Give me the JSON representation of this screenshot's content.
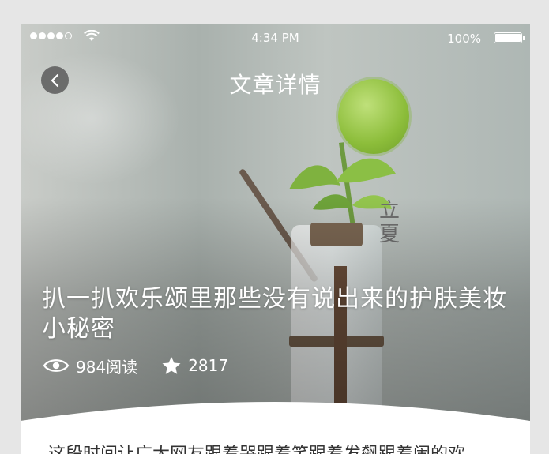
{
  "status_bar": {
    "time": "4:34 PM",
    "battery_percent": "100%",
    "signal_strength": 4,
    "signal_max": 5,
    "wifi_icon": "wifi-icon"
  },
  "nav": {
    "title": "文章详情",
    "back_icon": "chevron-left-icon"
  },
  "hero": {
    "stamp_text": "立夏"
  },
  "article": {
    "title": "扒一扒欢乐颂里那些没有说出来的护肤美妆小秘密",
    "views": "984阅读",
    "likes": "2817",
    "body_preview": "这段时间让广大网友跟着哭跟着笑跟着发飙跟着闹的欢"
  },
  "colors": {
    "back_button_bg": "#5a5a5a",
    "text_on_image": "#ffffff",
    "body_text": "#333333"
  }
}
